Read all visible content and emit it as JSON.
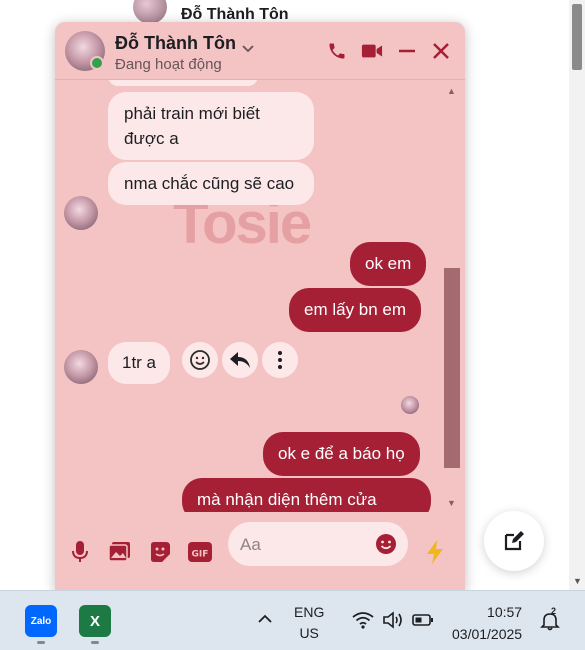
{
  "background": {
    "contact_name": "Đỗ Thành Tôn"
  },
  "chat": {
    "contact_name": "Đỗ Thành Tôn",
    "status": "Đang hoạt động",
    "watermark": "Tosie",
    "messages": [
      {
        "from": "contact",
        "text": "phải train mới biết được a"
      },
      {
        "from": "contact",
        "text": "nma chắc cũng sẽ cao"
      },
      {
        "from": "me",
        "text": "ok em"
      },
      {
        "from": "me",
        "text": "em lấy bn em"
      },
      {
        "from": "contact",
        "text": "1tr a"
      },
      {
        "from": "me",
        "text": "ok e để a báo họ"
      },
      {
        "from": "me",
        "text": "mà nhận diện thêm cửa"
      }
    ],
    "composer": {
      "placeholder": "Aa"
    }
  },
  "taskbar": {
    "apps": [
      "Zalo",
      "Excel"
    ],
    "language_line1": "ENG",
    "language_line2": "US",
    "time": "10:57",
    "date": "03/01/2025",
    "notification_count": "2"
  },
  "colors": {
    "accent": "#a51f35",
    "chat_bg": "#f4c4c5",
    "incoming_bubble": "#fde8e9"
  }
}
